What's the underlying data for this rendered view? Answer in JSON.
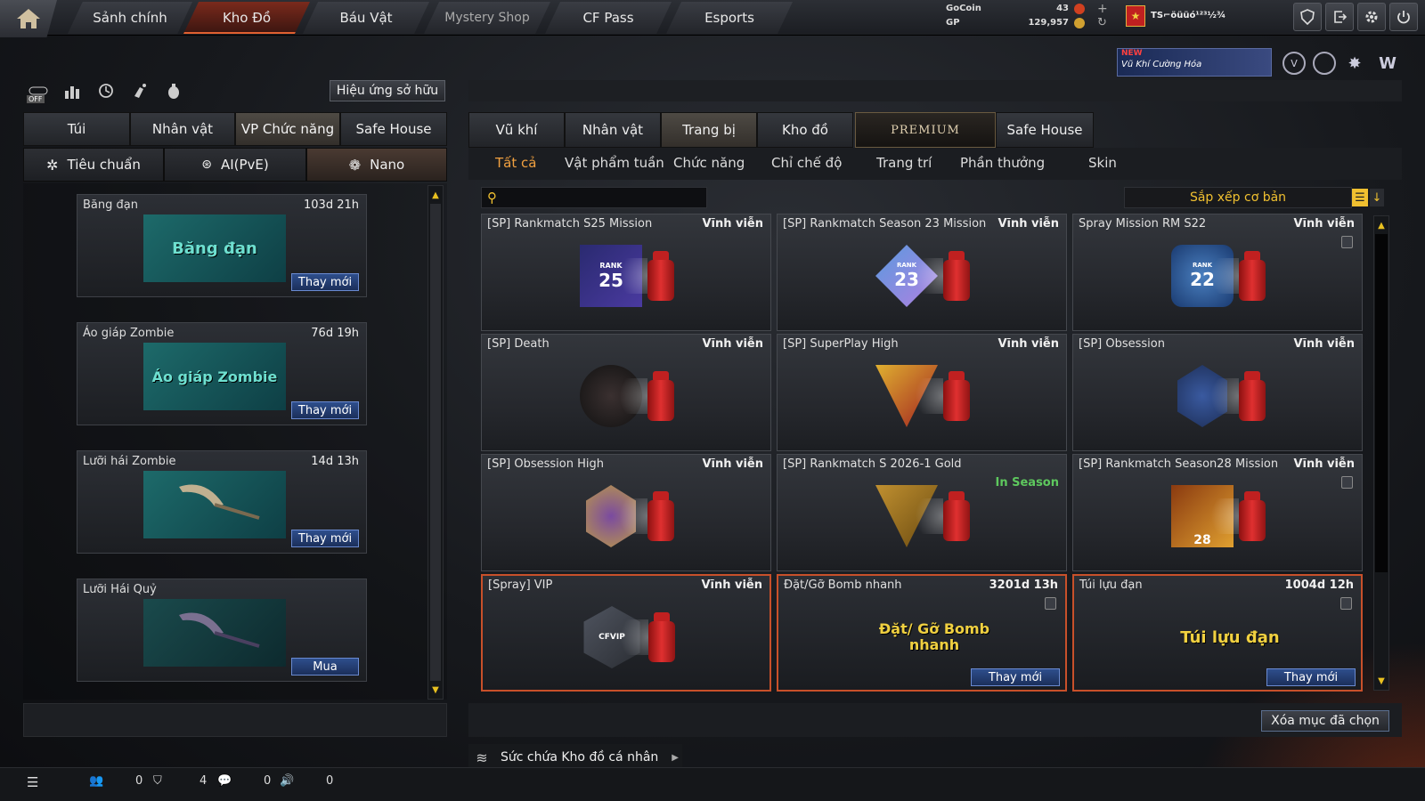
{
  "nav": {
    "tabs": [
      {
        "label": "Sảnh chính"
      },
      {
        "label": "Kho Đồ"
      },
      {
        "label": "Báu Vật"
      },
      {
        "label": "Mystery Shop"
      },
      {
        "label": "CF Pass"
      },
      {
        "label": "Esports"
      }
    ],
    "active_tab": "Kho Đồ"
  },
  "currency": {
    "gocoin_label": "GoCoin",
    "gocoin_value": "43",
    "gp_label": "GP",
    "gp_value": "129,957"
  },
  "player": {
    "name": "TS⌐öüüó¹²³½¾"
  },
  "banner": {
    "new": "NEW",
    "text": "Vũ Khí Cường Hóa"
  },
  "left": {
    "owned_effect_button": "Hiệu ứng sở hữu",
    "toggle_off": "OFF",
    "tabs": [
      {
        "label": "Túi"
      },
      {
        "label": "Nhân vật"
      },
      {
        "label": "VP Chức năng"
      },
      {
        "label": "Safe House"
      }
    ],
    "subtabs": [
      {
        "label": "Tiêu chuẩn"
      },
      {
        "label": "AI(PvE)"
      },
      {
        "label": "Nano"
      }
    ],
    "items": [
      {
        "name": "Băng đạn",
        "time": "103d 21h",
        "art_text": "Băng đạn",
        "action": "Thay mới"
      },
      {
        "name": "Áo giáp Zombie",
        "time": "76d 19h",
        "art_text": "Áo giáp Zombie",
        "action": "Thay mới"
      },
      {
        "name": "Lưỡi hái Zombie",
        "time": "14d 13h",
        "art_text": "",
        "action": "Thay mới"
      },
      {
        "name": "Lưỡi Hái Quỷ",
        "time": "",
        "art_text": "",
        "action": "Mua"
      }
    ]
  },
  "right": {
    "tabs": [
      {
        "label": "Vũ khí"
      },
      {
        "label": "Nhân vật"
      },
      {
        "label": "Trang bị"
      },
      {
        "label": "Kho đồ"
      },
      {
        "label": "PREMIUM"
      },
      {
        "label": "Safe House"
      }
    ],
    "filters": [
      {
        "label": "Tất cả"
      },
      {
        "label": "Vật phẩm tuần"
      },
      {
        "label": "Chức năng"
      },
      {
        "label": "Chỉ chế độ"
      },
      {
        "label": "Trang trí"
      },
      {
        "label": "Phần thưởng"
      },
      {
        "label": "Skin"
      }
    ],
    "search": {
      "placeholder": ""
    },
    "sort_label": "Sắp xếp cơ bản",
    "items": [
      {
        "name": "[SP] Rankmatch S25 Mission",
        "time": "Vĩnh viễn",
        "badge": "25",
        "badge_word": "RANK"
      },
      {
        "name": "[SP] Rankmatch Season 23 Mission",
        "time": "Vĩnh viễn",
        "badge": "23",
        "badge_word": "RANK"
      },
      {
        "name": "Spray Mission RM S22",
        "time": "Vĩnh viễn",
        "badge": "22",
        "badge_word": "RANK"
      },
      {
        "name": "[SP] Death",
        "time": "Vĩnh viễn",
        "badge": "",
        "badge_word": ""
      },
      {
        "name": "[SP] SuperPlay High",
        "time": "Vĩnh viễn",
        "badge": "",
        "badge_word": ""
      },
      {
        "name": "[SP] Obsession",
        "time": "Vĩnh viễn",
        "badge": "",
        "badge_word": ""
      },
      {
        "name": "[SP] Obsession High",
        "time": "Vĩnh viễn",
        "badge": "",
        "badge_word": ""
      },
      {
        "name": "[SP] Rankmatch S 2026-1 Gold",
        "time": "",
        "season": "In Season",
        "badge": "",
        "badge_word": ""
      },
      {
        "name": "[SP] Rankmatch Season28 Mission",
        "time": "Vĩnh viễn",
        "badge": "28",
        "badge_word": ""
      },
      {
        "name": "[Spray] VIP",
        "time": "Vĩnh viễn",
        "badge": "CFVIP",
        "badge_word": ""
      },
      {
        "name": "Đặt/Gỡ Bomb nhanh",
        "time": "3201d 13h",
        "art_text": "Đặt/ Gỡ Bomb nhanh",
        "action": "Thay mới"
      },
      {
        "name": "Túi lựu đạn",
        "time": "1004d 12h",
        "art_text": "Túi lựu đạn",
        "action": "Thay mới"
      }
    ],
    "delete_selected": "Xóa mục đã chọn",
    "capacity_label": "Sức chứa Kho đồ cá nhân"
  },
  "statusbar": {
    "friends": "0",
    "clan": "4",
    "chat": "0",
    "voice": "0"
  },
  "colors": {
    "accent": "#c8502a",
    "action_blue": "#2e4e8c",
    "season_green": "#5ec85e",
    "scroll_arrow": "#e8c020"
  }
}
